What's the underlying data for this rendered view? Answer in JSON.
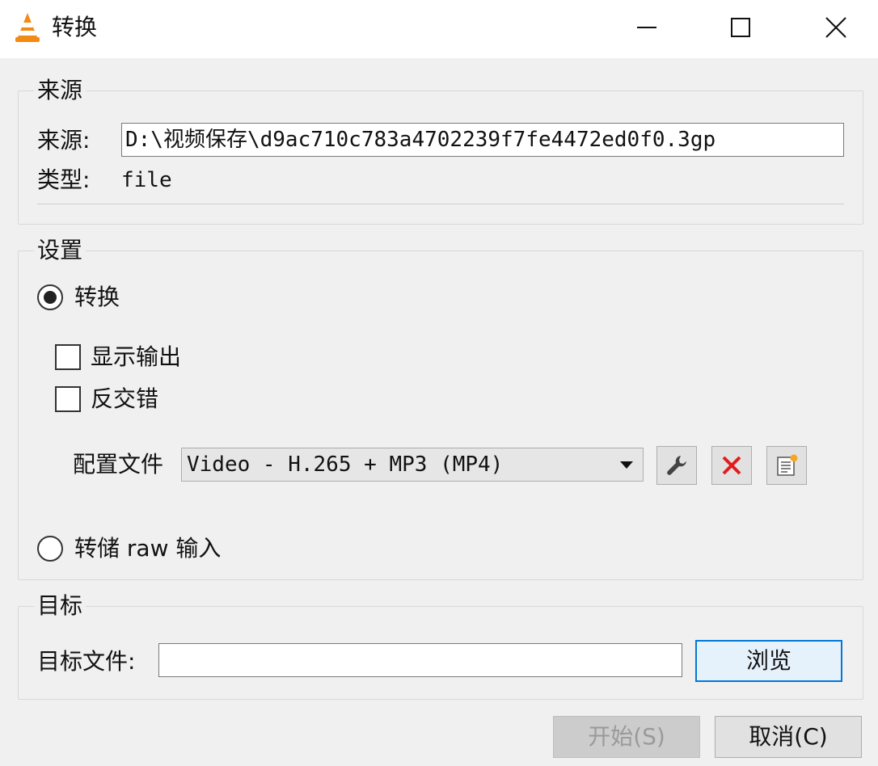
{
  "window": {
    "title": "转换",
    "icon": "vlc-cone-icon"
  },
  "source_group": {
    "title": "来源",
    "source_label": "来源:",
    "source_value": "D:\\视频保存\\d9ac710c783a4702239f7fe4472ed0f0.3gp",
    "type_label": "类型:",
    "type_value": "file"
  },
  "settings_group": {
    "title": "设置",
    "convert_label": "转换",
    "convert_checked": true,
    "show_output_label": "显示输出",
    "show_output_checked": false,
    "deinterlace_label": "反交错",
    "deinterlace_checked": false,
    "profile_label": "配置文件",
    "profile_value": "Video - H.265 + MP3 (MP4)",
    "dump_raw_label": "转储 raw 输入",
    "dump_raw_checked": false,
    "tool_icons": [
      "wrench-icon",
      "delete-red-x-icon",
      "new-profile-icon"
    ]
  },
  "dest_group": {
    "title": "目标",
    "dest_label": "目标文件:",
    "dest_value": "",
    "browse_label": "浏览"
  },
  "footer": {
    "start_label": "开始(S)",
    "start_enabled": false,
    "cancel_label": "取消(C)"
  },
  "colors": {
    "vlc_orange": "#f28a14",
    "delete_red": "#e21b1b",
    "focus_blue": "#0078d7"
  }
}
